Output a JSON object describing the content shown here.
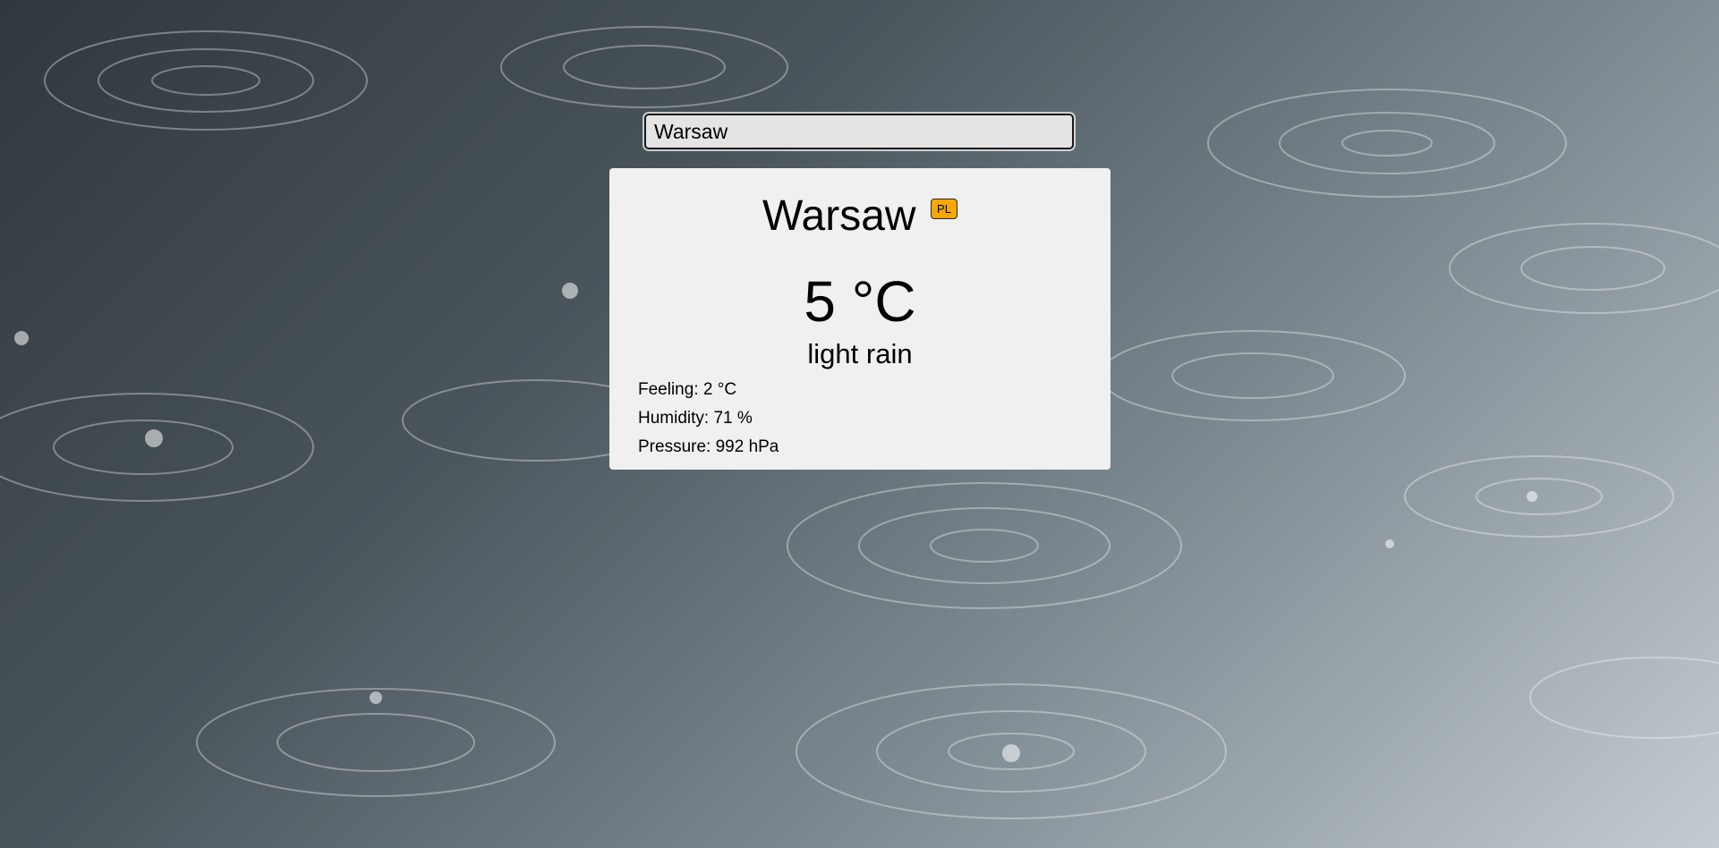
{
  "search": {
    "value": "Warsaw"
  },
  "weather": {
    "city": "Warsaw",
    "country_code": "PL",
    "temperature": "5 °C",
    "description": "light rain",
    "details": {
      "feeling": "Feeling: 2 °C",
      "humidity": "Humidity: 71 %",
      "pressure": "Pressure: 992 hPa"
    }
  },
  "colors": {
    "card_background": "#f0f0f0",
    "badge": "#f5a800",
    "input_background": "#e4e4e4"
  },
  "background": {
    "icon": "rain-ripples-image"
  }
}
